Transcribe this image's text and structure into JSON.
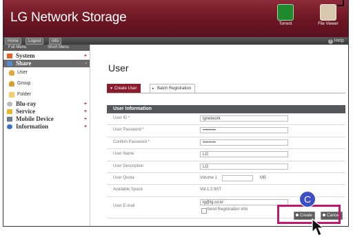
{
  "header": {
    "title": "LG Network Storage",
    "torrent_label": "Torrent",
    "fileviewer_label": "File Viewer"
  },
  "toolbar": {
    "home": "Home",
    "logout": "Logout",
    "info": "Info",
    "help": "Help"
  },
  "sidebar": {
    "tab_full": "Full Menu",
    "tab_short": "Short Menu",
    "items": [
      {
        "label": "System",
        "icon": "system-icon"
      },
      {
        "label": "Share",
        "icon": "share-icon",
        "active": true
      },
      {
        "label": "User",
        "icon": "user-icon",
        "sub": true
      },
      {
        "label": "Group",
        "icon": "group-icon",
        "sub": true
      },
      {
        "label": "Folder",
        "icon": "folder-icon",
        "sub": true
      },
      {
        "label": "Blu-ray",
        "icon": "disc-icon"
      },
      {
        "label": "Service",
        "icon": "star-icon"
      },
      {
        "label": "Mobile Device",
        "icon": "mobile-icon"
      },
      {
        "label": "Information",
        "icon": "info-icon"
      }
    ]
  },
  "main": {
    "title": "User",
    "tabs": [
      "Create User",
      "Batch Registration"
    ],
    "panel_title": "User Information",
    "fields": {
      "user_id": {
        "label": "User ID *",
        "value": "lgnetwork"
      },
      "password": {
        "label": "User Password *",
        "value": "•••••••••"
      },
      "confirm": {
        "label": "Confirm Password *",
        "value": "•••••••••"
      },
      "name": {
        "label": "User Name",
        "value": "LG"
      },
      "description": {
        "label": "User Description",
        "value": "LG"
      },
      "quota": {
        "label": "User Quota",
        "volume": "Volume 1",
        "value": "",
        "unit": "MB"
      },
      "space": {
        "label": "Available Space",
        "value": "Vol.1:2.9ST"
      },
      "email": {
        "label": "User E-mail",
        "value": "lg@lg.co.kr",
        "send_label": "Send Registration Info"
      }
    },
    "buttons": {
      "create": "Create",
      "cancel": "Cancel"
    }
  },
  "annotation": {
    "marker": "C"
  },
  "colors": {
    "brand": "#6b1522",
    "highlight": "#c0186e",
    "marker": "#3c4fc4"
  }
}
